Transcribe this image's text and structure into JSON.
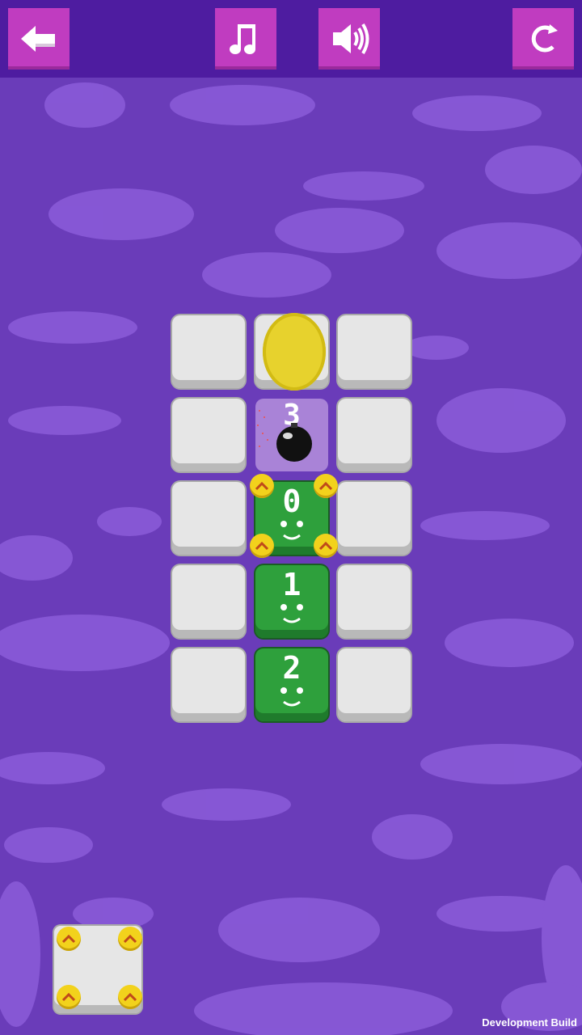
{
  "toolbar": {
    "back_icon": "arrow-left-icon",
    "music_icon": "music-note-icon",
    "sound_icon": "speaker-icon",
    "restart_icon": "restart-icon",
    "button_color": "#c03cc0",
    "bar_color": "#4e1ca0"
  },
  "board": {
    "bomb_counter": "3",
    "blocks": [
      {
        "number": "0"
      },
      {
        "number": "1"
      },
      {
        "number": "2"
      }
    ],
    "tile_color": "#e6e6e6",
    "block_color": "#2ea03c",
    "coin_color": "#e7d22d"
  },
  "footer": {
    "dev_build_label": "Development Build"
  }
}
